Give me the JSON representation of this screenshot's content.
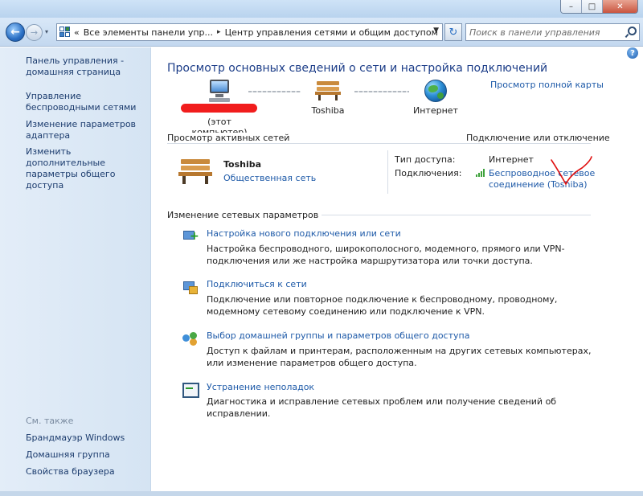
{
  "window": {
    "minimize": "–",
    "maximize": "□",
    "close": "✕"
  },
  "navbar": {
    "back": "←",
    "forward": "→",
    "recent": "▾",
    "crumb_prefix": "«",
    "crumbs": [
      "Все элементы панели упр...",
      "Центр управления сетями и общим доступом"
    ],
    "separator": "▸",
    "dropdown": "▼",
    "refresh": "↻",
    "search_placeholder": "Поиск в панели управления"
  },
  "sidebar": {
    "items": [
      "Панель управления - домашняя страница",
      "Управление беспроводными сетями",
      "Изменение параметров адаптера",
      "Изменить дополнительные параметры общего доступа"
    ],
    "see_also": "См. также",
    "see_also_items": [
      "Брандмауэр Windows",
      "Домашняя группа",
      "Свойства браузера"
    ]
  },
  "main": {
    "help": "?",
    "title": "Просмотр основных сведений о сети и настройка подключений",
    "full_map_link": "Просмотр полной карты",
    "network_map": {
      "this_computer": "(этот компьютер)",
      "network": "Toshiba",
      "internet": "Интернет"
    },
    "active_networks": {
      "label": "Просмотр активных сетей",
      "connect_link": "Подключение или отключение",
      "network_name": "Toshiba",
      "network_type": "Общественная сеть",
      "access_type_label": "Тип доступа:",
      "access_type_value": "Интернет",
      "connections_label": "Подключения:",
      "connection_line1": "Беспроводное сетевое",
      "connection_line2": "соединение (Toshiba)"
    },
    "change_settings": {
      "label": "Изменение сетевых параметров",
      "tasks": [
        {
          "icon": "new-connection-icon",
          "link": "Настройка нового подключения или сети",
          "description": "Настройка беспроводного, широкополосного, модемного, прямого или VPN-подключения или же настройка маршрутизатора или точки доступа."
        },
        {
          "icon": "connect-network-icon",
          "link": "Подключиться к сети",
          "description": "Подключение или повторное подключение к беспроводному, проводному, модемному сетевому соединению или подключение к VPN."
        },
        {
          "icon": "homegroup-icon",
          "link": "Выбор домашней группы и параметров общего доступа",
          "description": "Доступ к файлам и принтерам, расположенным на других сетевых компьютерах, или изменение параметров общего доступа."
        },
        {
          "icon": "troubleshoot-icon",
          "link": "Устранение неполадок",
          "description": "Диагностика и исправление сетевых проблем или получение сведений об исправлении."
        }
      ]
    }
  },
  "colors": {
    "link": "#1e5aa8",
    "title": "#1c3d88",
    "sidebar_link": "#1c3c6e",
    "redaction": "#f11d1d",
    "annotation": "#e01010"
  }
}
